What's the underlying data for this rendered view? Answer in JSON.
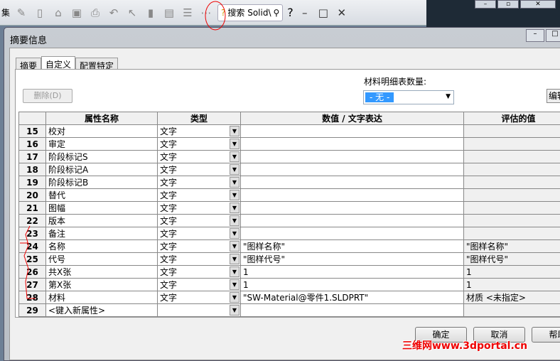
{
  "toolbar": {
    "left_text": "集",
    "search_label": "搜索 Solid\\",
    "help": "?"
  },
  "dialog": {
    "title": "摘要信息",
    "tabs": [
      "摘要",
      "自定义",
      "配置特定"
    ],
    "delete_button": "删除(D)",
    "bom_label": "材料明细表数量:",
    "bom_value": "- 无 -",
    "edit_button": "编辑",
    "columns": [
      "",
      "属性名称",
      "类型",
      "数值 / 文字表达",
      "评估的值"
    ],
    "rows": [
      {
        "num": "15",
        "name": "校对",
        "type": "文字",
        "value": "",
        "evaluated": ""
      },
      {
        "num": "16",
        "name": "审定",
        "type": "文字",
        "value": "",
        "evaluated": ""
      },
      {
        "num": "17",
        "name": "阶段标记S",
        "type": "文字",
        "value": "",
        "evaluated": ""
      },
      {
        "num": "18",
        "name": "阶段标记A",
        "type": "文字",
        "value": "",
        "evaluated": ""
      },
      {
        "num": "19",
        "name": "阶段标记B",
        "type": "文字",
        "value": "",
        "evaluated": ""
      },
      {
        "num": "20",
        "name": "替代",
        "type": "文字",
        "value": "",
        "evaluated": ""
      },
      {
        "num": "21",
        "name": "图幅",
        "type": "文字",
        "value": "",
        "evaluated": ""
      },
      {
        "num": "22",
        "name": "版本",
        "type": "文字",
        "value": "",
        "evaluated": ""
      },
      {
        "num": "23",
        "name": "备注",
        "type": "文字",
        "value": "",
        "evaluated": ""
      },
      {
        "num": "24",
        "name": "名称",
        "type": "文字",
        "value": "\"图样名称\"",
        "evaluated": "\"图样名称\""
      },
      {
        "num": "25",
        "name": "代号",
        "type": "文字",
        "value": "\"图样代号\"",
        "evaluated": "\"图样代号\""
      },
      {
        "num": "26",
        "name": "共X张",
        "type": "文字",
        "value": "1",
        "evaluated": "1"
      },
      {
        "num": "27",
        "name": "第X张",
        "type": "文字",
        "value": "1",
        "evaluated": "1"
      },
      {
        "num": "28",
        "name": "材料",
        "type": "文字",
        "value": "\"SW-Material@零件1.SLDPRT\"",
        "evaluated": "材质 <未指定>"
      },
      {
        "num": "29",
        "name": "<键入新属性>",
        "type": "",
        "value": "",
        "evaluated": ""
      }
    ],
    "ok": "确定",
    "cancel": "取消",
    "help": "帮助"
  },
  "watermark": "三维网www.3dportal.cn"
}
